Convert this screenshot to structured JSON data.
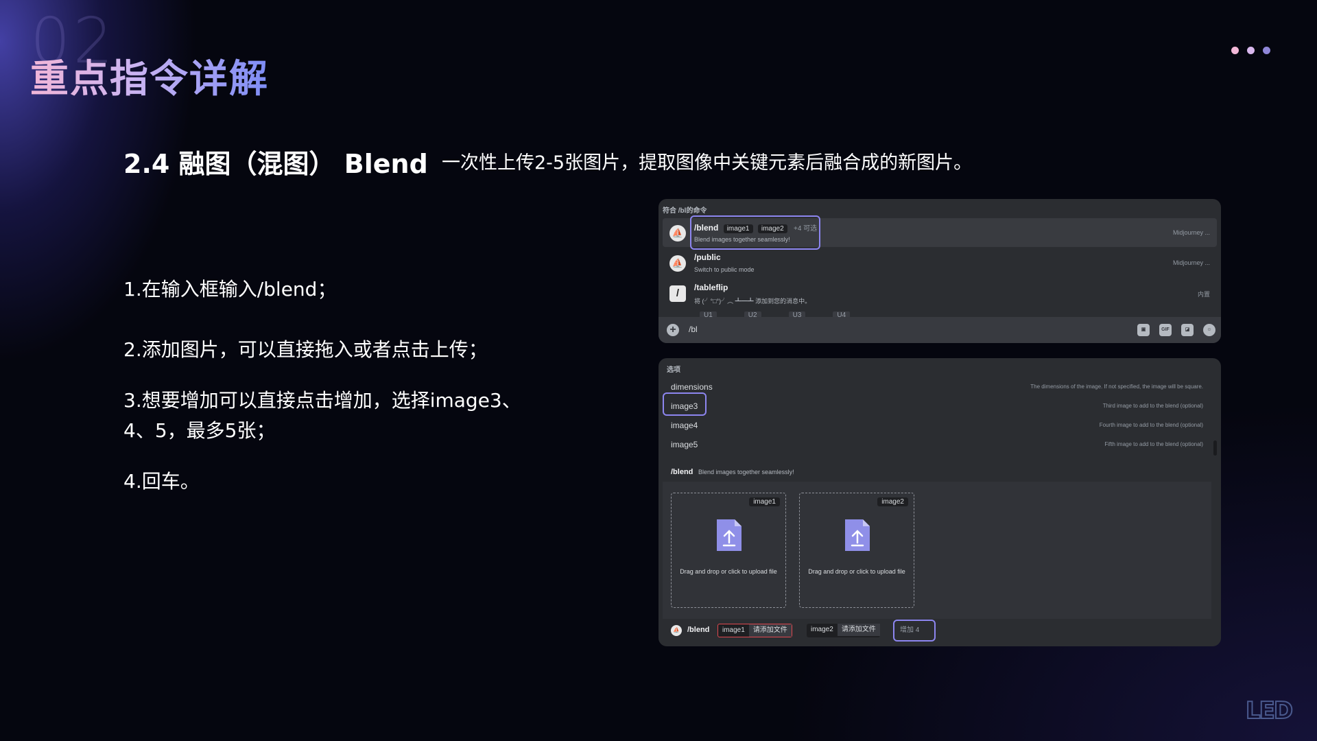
{
  "slide": {
    "number": "02",
    "title": "重点指令详解",
    "dot_colors": [
      "#f3b8d8",
      "#d9b8ee",
      "#8f86d8"
    ],
    "section_title": "2.4  融图（混图） Blend",
    "section_desc": "一次性上传2-5张图片，提取图像中关键元素后融合成的新图片。",
    "steps": [
      "1.在输入框输入/blend；",
      "2.添加图片，可以直接拖入或者点击上传；",
      "3.想要增加可以直接点击增加，选择image3、4、5，最多5张；",
      "4.回车。"
    ],
    "logo": "LED"
  },
  "screenshot_top": {
    "heading": "符合 /bl的命令",
    "commands": [
      {
        "name": "/blend",
        "args": [
          "image1",
          "image2"
        ],
        "extra": "+4 可选",
        "desc": "Blend images together seamlessly!",
        "source": "Midjourney ...",
        "icon": "bot-avatar-icon"
      },
      {
        "name": "/public",
        "desc": "Switch to public mode",
        "source": "Midjourney ...",
        "icon": "bot-avatar-icon"
      },
      {
        "name": "/tableflip",
        "desc": "将 (╯°□°)╯︵ ┻━┻ 添加到您的消息中。",
        "source": "内置",
        "icon": "slash-icon"
      }
    ],
    "background_ticks": [
      "U1",
      "U2",
      "U3",
      "U4"
    ],
    "input_value": "/bl",
    "tool_icons": [
      "gift-icon",
      "gif-icon",
      "sticker-icon",
      "emoji-icon"
    ],
    "gif_label": "GIF"
  },
  "screenshot_bottom": {
    "heading": "选项",
    "options": [
      {
        "name": "dimensions",
        "desc": "The dimensions of the image. If not specified, the image will be square."
      },
      {
        "name": "image3",
        "desc": "Third image to add to the blend (optional)"
      },
      {
        "name": "image4",
        "desc": "Fourth image to add to the blend (optional)"
      },
      {
        "name": "image5",
        "desc": "Fifth image to add to the blend (optional)"
      }
    ],
    "blend_cmd": "/blend",
    "blend_desc": "Blend images together seamlessly!",
    "uploads": [
      {
        "tag": "image1",
        "text": "Drag and drop or click to upload file"
      },
      {
        "tag": "image2",
        "text": "Drag and drop or click to upload file"
      }
    ],
    "bottom_bar": {
      "cmd": "/blend",
      "chips": [
        {
          "key": "image1",
          "value": "请添加文件"
        },
        {
          "key": "image2",
          "value": "请添加文件"
        }
      ],
      "add_label": "增加 4"
    }
  }
}
